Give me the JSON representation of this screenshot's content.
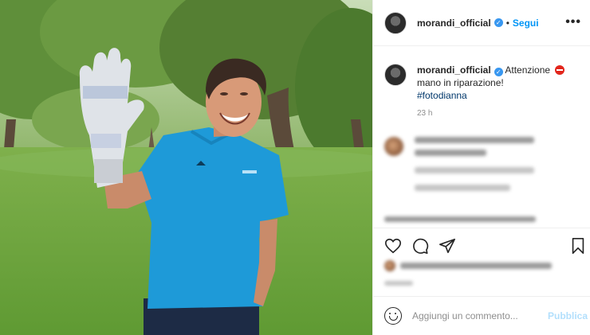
{
  "post": {
    "username": "morandi_official",
    "follow_label": "Segui",
    "separator": "•",
    "more_label": "•••",
    "verified_mark": "✓",
    "caption_prefix": "Attenzione",
    "caption_line2": "mano in riparazione!",
    "hashtag": "#fotodianna",
    "time_ago": "23 h",
    "comment_placeholder": "Aggiungi un commento...",
    "publish_label": "Pubblica"
  },
  "icons": {
    "verified": "verified-badge-icon",
    "stop": "no-entry-emoji-icon",
    "like": "heart-icon",
    "comment": "comment-bubble-icon",
    "share": "paper-plane-icon",
    "save": "bookmark-icon",
    "emoji": "emoji-smiley-icon"
  },
  "colors": {
    "link_blue": "#0095f6",
    "hashtag": "#00376b",
    "publish_disabled": "#b2dffc",
    "muted": "#8e8e8e",
    "shirt": "#1e9ad8"
  }
}
